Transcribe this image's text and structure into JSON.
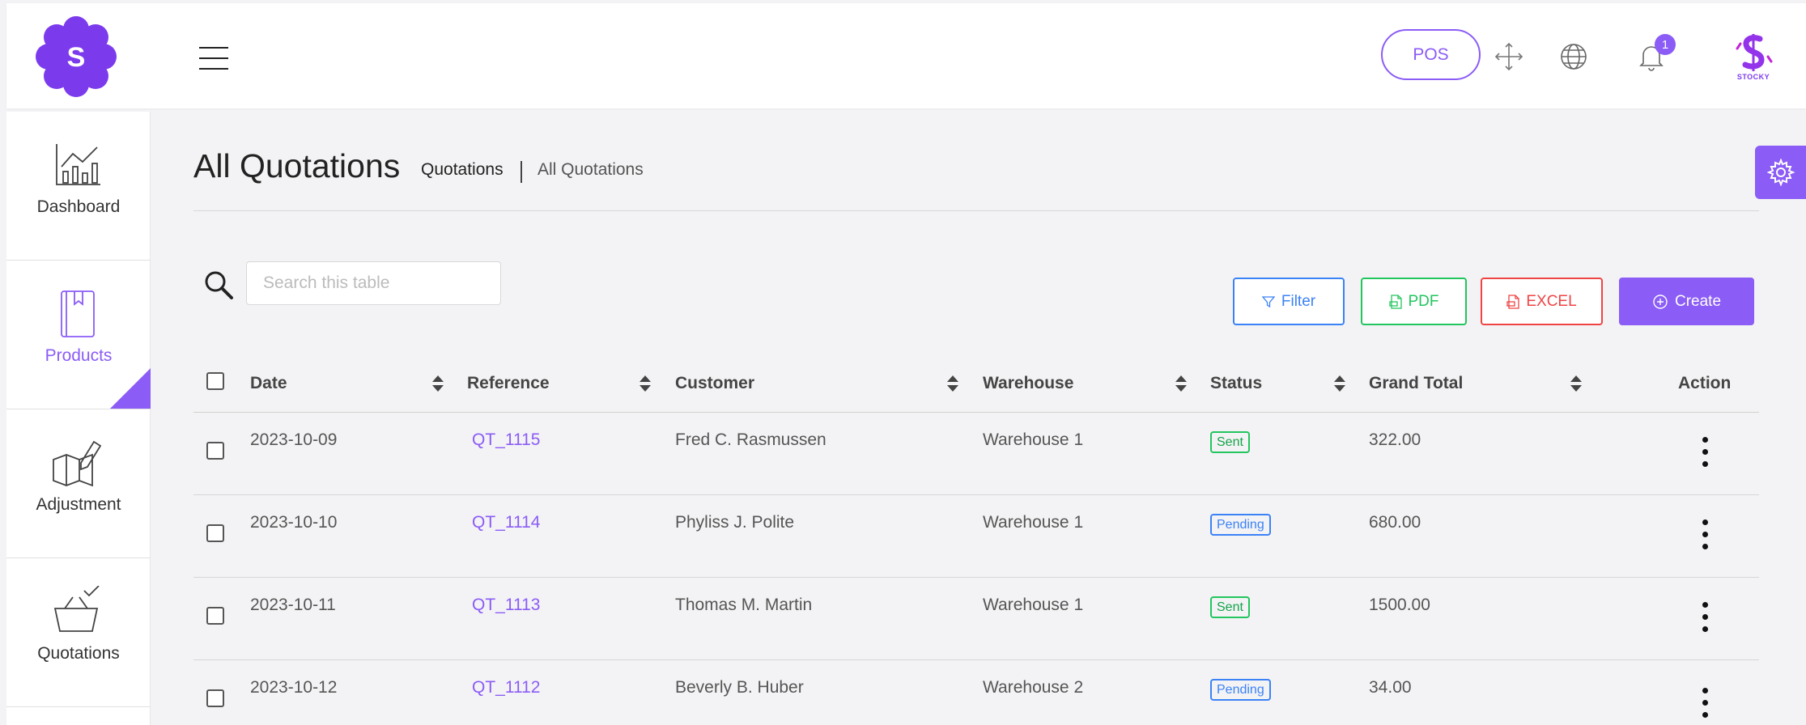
{
  "header": {
    "pos_label": "POS",
    "notification_count": "1",
    "brand_text": "STOCKY",
    "logo_letter": "S"
  },
  "sidebar": {
    "items": [
      {
        "label": "Dashboard",
        "icon": "dashboard-chart-icon"
      },
      {
        "label": "Products",
        "icon": "book-icon",
        "active": true
      },
      {
        "label": "Adjustment",
        "icon": "map-pencil-icon"
      },
      {
        "label": "Quotations",
        "icon": "basket-check-icon"
      }
    ]
  },
  "page": {
    "title": "All Quotations",
    "breadcrumb": [
      "Quotations",
      "All Quotations"
    ]
  },
  "toolbar": {
    "search_placeholder": "Search this table",
    "filter_label": "Filter",
    "pdf_label": "PDF",
    "excel_label": "EXCEL",
    "create_label": "Create"
  },
  "table": {
    "columns": [
      "Date",
      "Reference",
      "Customer",
      "Warehouse",
      "Status",
      "Grand Total",
      "Action"
    ],
    "rows": [
      {
        "date": "2023-10-09",
        "reference": "QT_1115",
        "customer": "Fred C. Rasmussen",
        "warehouse": "Warehouse 1",
        "status": "Sent",
        "grand_total": "322.00"
      },
      {
        "date": "2023-10-10",
        "reference": "QT_1114",
        "customer": "Phyliss J. Polite",
        "warehouse": "Warehouse 1",
        "status": "Pending",
        "grand_total": "680.00"
      },
      {
        "date": "2023-10-11",
        "reference": "QT_1113",
        "customer": "Thomas M. Martin",
        "warehouse": "Warehouse 1",
        "status": "Sent",
        "grand_total": "1500.00"
      },
      {
        "date": "2023-10-12",
        "reference": "QT_1112",
        "customer": "Beverly B. Huber",
        "warehouse": "Warehouse 2",
        "status": "Pending",
        "grand_total": "34.00"
      }
    ]
  },
  "colors": {
    "accent": "#8b5cf6",
    "filter": "#3b82f6",
    "pdf": "#22c55e",
    "excel": "#ef4444"
  }
}
